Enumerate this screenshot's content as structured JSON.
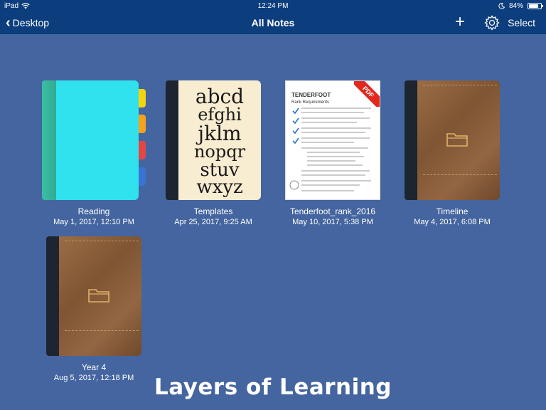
{
  "status": {
    "device": "iPad",
    "time": "12:24 PM",
    "battery_text": "84%",
    "battery_level": 0.84
  },
  "nav": {
    "back_label": "Desktop",
    "title": "All Notes",
    "select_label": "Select"
  },
  "notebooks": [
    {
      "name": "Reading",
      "date": "May 1, 2017, 12:10 PM",
      "cover": "teal-tabs"
    },
    {
      "name": "Templates",
      "date": "Apr 25, 2017, 9:25 AM",
      "cover": "alphabet"
    },
    {
      "name": "Tenderfoot_rank_2016",
      "date": "May 10, 2017, 5:38 PM",
      "cover": "pdf",
      "badge": "PDF",
      "doc_heading": "TENDERFOOT",
      "doc_subheading": "Rank Requirements"
    },
    {
      "name": "Timeline",
      "date": "May 4, 2017, 6:08 PM",
      "cover": "leather"
    },
    {
      "name": "Year 4",
      "date": "Aug 5, 2017, 12:18 PM",
      "cover": "leather"
    }
  ],
  "alphabet_glyphs": [
    "abcd",
    "efghi",
    "jklm",
    "nopqr",
    "stuv",
    "wxyz"
  ],
  "tab_colors": [
    "#f4d40f",
    "#f7a21b",
    "#e54545",
    "#3c72d6"
  ],
  "watermark": "Layers of Learning",
  "colors": {
    "background": "#44659f",
    "bar": "#0c3d7c"
  }
}
